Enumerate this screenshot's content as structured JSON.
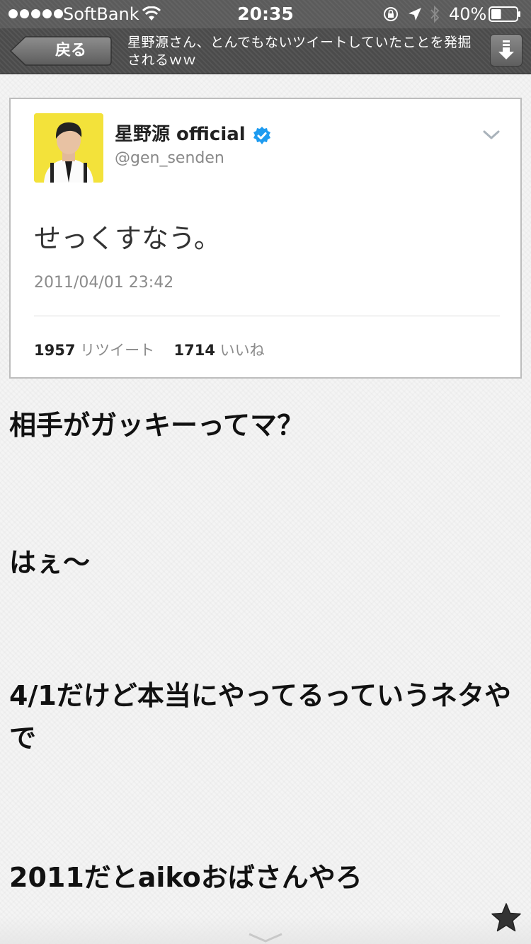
{
  "status_bar": {
    "carrier": "SoftBank",
    "time": "20:35",
    "battery_percent": "40%",
    "battery_level": 0.4
  },
  "nav": {
    "back_label": "戻る",
    "title": "星野源さん、とんでもないツイートしていたことを発掘されるｗｗ"
  },
  "tweet": {
    "author_name": "星野源 official",
    "handle": "@gen_senden",
    "text": "せっくすなう。",
    "date": "2011/04/01 23:42",
    "retweets": "1957",
    "retweets_label": "リツイート",
    "likes": "1714",
    "likes_label": "いいね"
  },
  "comments": [
    "相手がガッキーってマ？",
    "はぇ～",
    "4/1だけど本当にやってるっていうネタやで",
    "2011だとaikoおばさんやろ"
  ],
  "colors": {
    "status_bar": "#5b5b5b",
    "nav_bar": "#4b4b4b",
    "verified_blue": "#1d9bf0",
    "avatar_yellow": "#f3e23a"
  }
}
